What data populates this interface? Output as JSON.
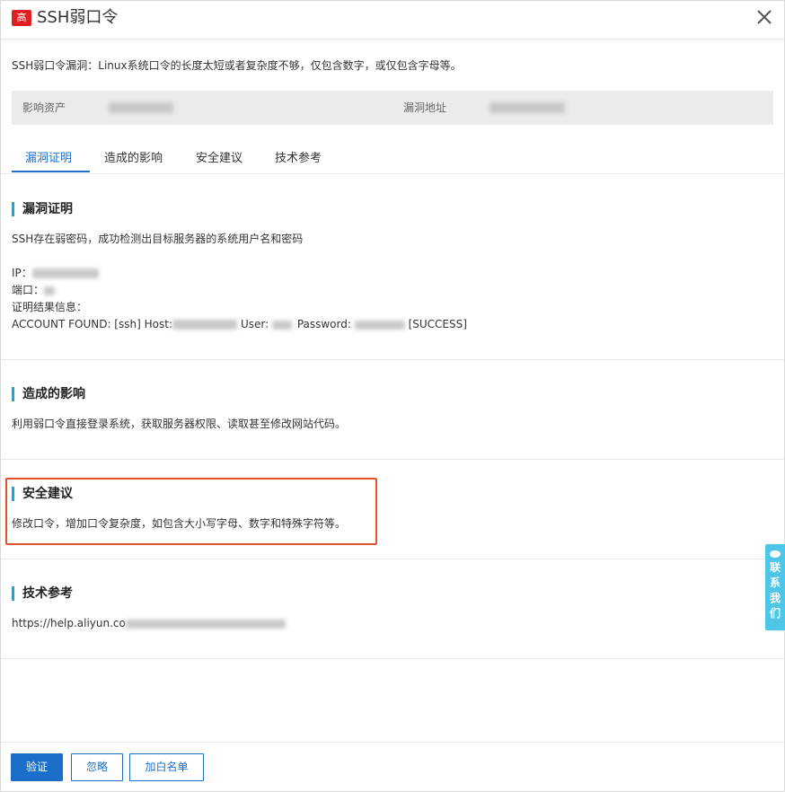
{
  "header": {
    "level_badge": "高",
    "title": "SSH弱口令"
  },
  "description": "SSH弱口令漏洞：Linux系统口令的长度太短或者复杂度不够，仅包含数字，或仅包含字母等。",
  "assets": {
    "asset_label": "影响资产",
    "address_label": "漏洞地址"
  },
  "tabs": [
    {
      "label": "漏洞证明",
      "active": true
    },
    {
      "label": "造成的影响",
      "active": false
    },
    {
      "label": "安全建议",
      "active": false
    },
    {
      "label": "技术参考",
      "active": false
    }
  ],
  "proof": {
    "title": "漏洞证明",
    "summary": "SSH存在弱密码，成功检测出目标服务器的系统用户名和密码",
    "ip_label": "IP：",
    "port_label": "端口：",
    "result_label": "证明结果信息：",
    "account_prefix": "ACCOUNT FOUND: [ssh] Host:",
    "user_label": "User:",
    "password_label": "Password:",
    "success": "[SUCCESS]"
  },
  "impact": {
    "title": "造成的影响",
    "text": "利用弱口令直接登录系统，获取服务器权限、读取甚至修改网站代码。"
  },
  "advice": {
    "title": "安全建议",
    "text": "修改口令，增加口令复杂度，如包含大小写字母、数字和特殊字符等。"
  },
  "reference": {
    "title": "技术参考",
    "url_prefix": "https://help.aliyun.co"
  },
  "footer": {
    "verify": "验证",
    "ignore": "忽略",
    "whitelist": "加白名单"
  },
  "contact": {
    "chars": [
      "联",
      "系",
      "我",
      "们"
    ]
  },
  "colors": {
    "accent": "#1b6fc8",
    "danger": "#e02020",
    "highlight": "#e2522f",
    "section_bar": "#12a8d8",
    "contact": "#4dc6e8"
  }
}
